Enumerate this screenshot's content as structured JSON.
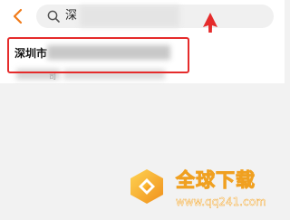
{
  "search": {
    "query": "深"
  },
  "results": [
    {
      "title": "深圳市",
      "subtitle_fragment": "司"
    }
  ],
  "watermark": {
    "title": "全球下载",
    "url": "www.qq241.com"
  },
  "colors": {
    "back_arrow": "#f07b1a",
    "annotation": "#e52b2b",
    "watermark": "#f0a020"
  }
}
